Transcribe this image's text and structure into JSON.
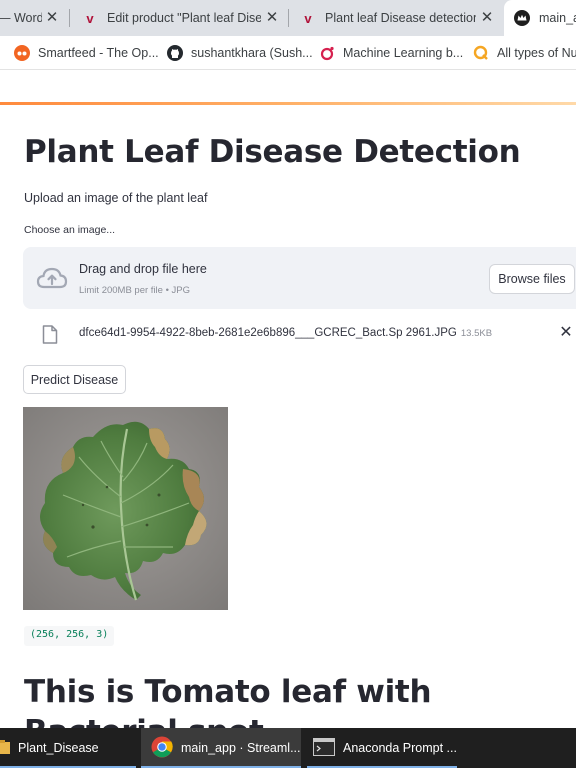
{
  "browser": {
    "tabs": [
      {
        "title": "— Word",
        "favicon": "wordpress-icon",
        "close": "✕"
      },
      {
        "title": "Edit product \"Plant leaf Disea",
        "favicon": "v",
        "close": "✕"
      },
      {
        "title": "Plant leaf Disease detection |",
        "favicon": "v",
        "close": "✕"
      },
      {
        "title": "main_a",
        "favicon": "streamlit-crown-icon",
        "active": true
      }
    ],
    "bookmarks": [
      {
        "label": "Smartfeed - The Op...",
        "icon": "smartfeed-icon"
      },
      {
        "label": "sushantkhara (Sush...",
        "icon": "github-icon"
      },
      {
        "label": "Machine Learning b...",
        "icon": "ml-icon"
      },
      {
        "label": "All types of Nu",
        "icon": "q-icon"
      }
    ]
  },
  "app": {
    "title": "Plant Leaf Disease Detection",
    "subtitle": "Upload an image of the plant leaf",
    "uploader": {
      "label": "Choose an image...",
      "drop_text": "Drag and drop file here",
      "limit_text": "Limit 200MB per file • JPG",
      "browse_label": "Browse files",
      "file_name": "dfce64d1-9954-4922-8beb-2681e2e6b896___GCREC_Bact.Sp 2961.JPG",
      "file_size": "13.5KB",
      "remove": "✕"
    },
    "predict_label": "Predict Disease",
    "shape_output": "(256, 256, 3)",
    "result_heading": "This is Tomato leaf with Bacterial spot"
  },
  "taskbar": {
    "items": [
      {
        "label": "Plant_Disease",
        "icon": "folder-icon"
      },
      {
        "label": "main_app · Streaml...",
        "icon": "chrome-icon",
        "active": true
      },
      {
        "label": "Anaconda Prompt ...",
        "icon": "terminal-icon"
      }
    ]
  },
  "colors": {
    "accent_orange": "#ff8a3d",
    "code_green": "#09805a",
    "dropzone_bg": "#f0f2f6",
    "tabstrip_bg": "#dee1e6",
    "taskbar_bg": "#1f1f1f"
  }
}
